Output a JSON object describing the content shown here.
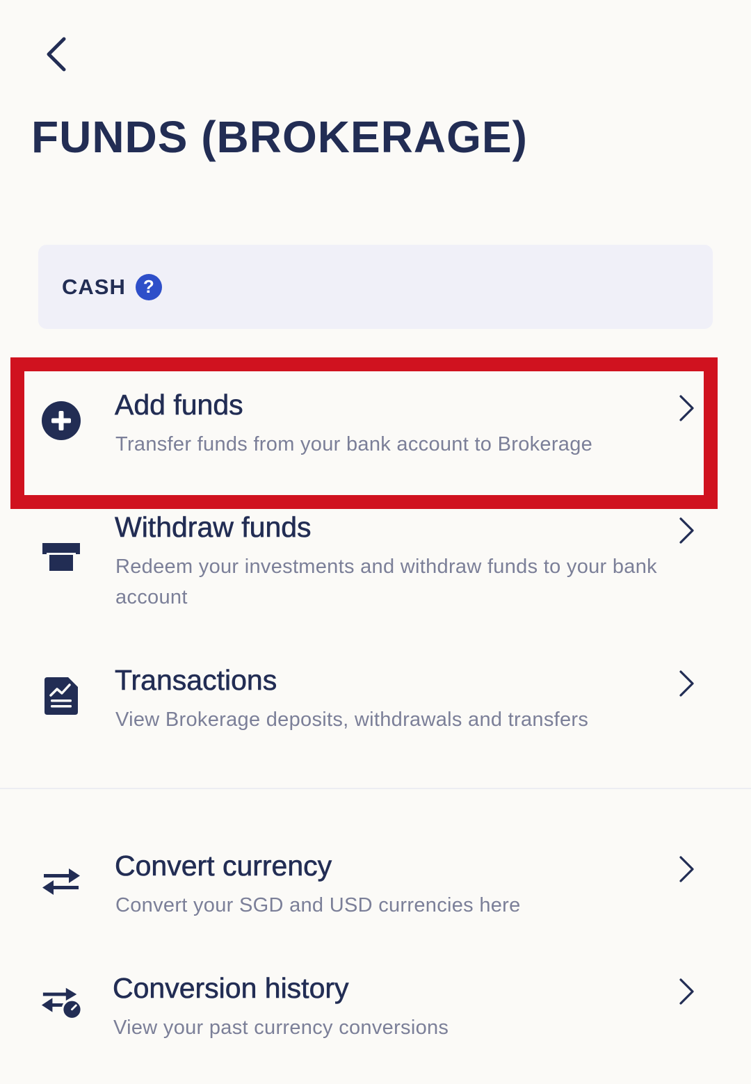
{
  "header": {
    "title": "FUNDS (BROKERAGE)"
  },
  "cash": {
    "label": "CASH",
    "help_glyph": "?"
  },
  "items": [
    {
      "id": "add-funds",
      "icon": "plus-circle-icon",
      "title": "Add funds",
      "subtitle": "Transfer funds from your bank account to Brokerage"
    },
    {
      "id": "withdraw-funds",
      "icon": "withdraw-icon",
      "title": "Withdraw funds",
      "subtitle": "Redeem your investments and withdraw funds to your bank account"
    },
    {
      "id": "transactions",
      "icon": "document-chart-icon",
      "title": "Transactions",
      "subtitle": "View Brokerage deposits, withdrawals and transfers"
    },
    {
      "id": "convert-currency",
      "icon": "swap-arrows-icon",
      "title": "Convert currency",
      "subtitle": "Convert your SGD and USD currencies here"
    },
    {
      "id": "conversion-history",
      "icon": "swap-history-icon",
      "title": "Conversion history",
      "subtitle": "View your past currency conversions"
    }
  ],
  "colors": {
    "background": "#fbfaf7",
    "navy": "#222d54",
    "subtitle": "#7b7f98",
    "card": "#f0f0f8",
    "help": "#2e4fc9",
    "highlight": "#d0121f"
  }
}
